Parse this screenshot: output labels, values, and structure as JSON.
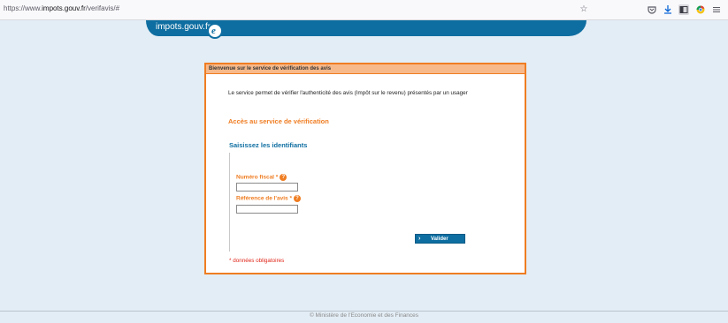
{
  "browser": {
    "url_prefix": "https://www.",
    "url_domain": "impots.gouv.fr",
    "url_path": "/verifavis/#",
    "icons": [
      "star-icon",
      "pocket-icon",
      "download-icon",
      "sidebar-icon",
      "extension-icon",
      "menu-icon"
    ]
  },
  "site": {
    "logo_text": "impots.gouv.fr",
    "logo_glyph": "e"
  },
  "panel": {
    "header": "Bienvenue sur le service de vérification des avis",
    "intro": "Le service permet de vérifier l'authenticité des avis (Impôt sur le revenu) présentés par un usager",
    "access_title": "Accès au service de vérification",
    "ident_title": "Saisissez les identifiants",
    "fields": [
      {
        "label": "Numéro fiscal *",
        "value": ""
      },
      {
        "label": "Référence de l'avis *",
        "value": ""
      }
    ],
    "help_glyph": "?",
    "validate_label": "Valider",
    "mandatory_note": "* données obligatoires"
  },
  "footer": {
    "text": "© Ministère de l'Economie et des Finances"
  },
  "colors": {
    "accent_orange": "#ef7d22",
    "brand_blue": "#0e6ea1",
    "error_red": "#e0261a"
  }
}
